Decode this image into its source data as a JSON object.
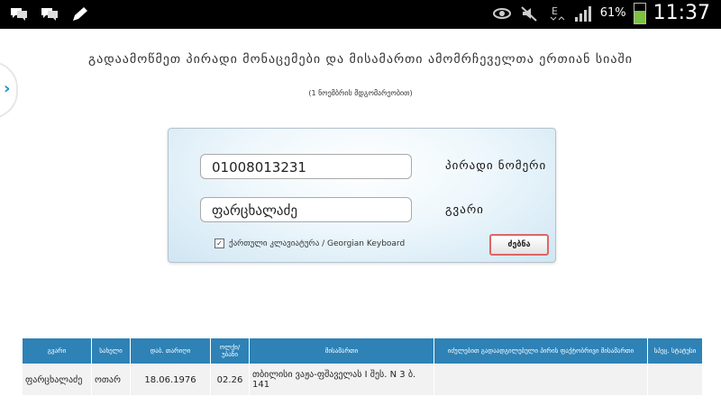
{
  "status_bar": {
    "battery_percent": "61%",
    "battery_level": 0.61,
    "time": "11:37",
    "left_icons": [
      "chat-icon",
      "chat-icon",
      "pencil-icon"
    ],
    "right_icons": [
      "eye-icon",
      "mute-icon",
      "data-e-icon",
      "signal-icon",
      "battery-icon"
    ]
  },
  "header": {
    "title": "გადაამოწმეთ პირადი მონაცემები და მისამართი ამომრჩეველთა ერთიან სიაში",
    "subtitle": "(1 ნოემბრის მდგომარეობით)"
  },
  "search": {
    "personal_number_value": "01008013231",
    "personal_number_label": "პირადი ნომერი",
    "surname_value": "ფარცხალაძე",
    "surname_label": "გვარი",
    "keyboard_checked": true,
    "keyboard_label": "ქართული კლავიატურა / Georgian Keyboard",
    "search_button": "ძებნა"
  },
  "results": {
    "headers": [
      "გვარი",
      "სახელი",
      "დაბ. თარიღი",
      "ოლქი/ უბანი",
      "მისამართი",
      "იძულებით გადაადგილებული პირის ფაქტობრივი მისამართი",
      "სპეც. სტატუსი"
    ],
    "rows": [
      [
        "ფარცხალაძე",
        "ოთარ",
        "18.06.1976",
        "02.26",
        "თბილისი ვაჟა-ფშაველას I შეს. N 3 ბ. 141",
        "",
        ""
      ]
    ]
  },
  "colors": {
    "accent": "#2e82b6",
    "button_border": "#d66666"
  }
}
